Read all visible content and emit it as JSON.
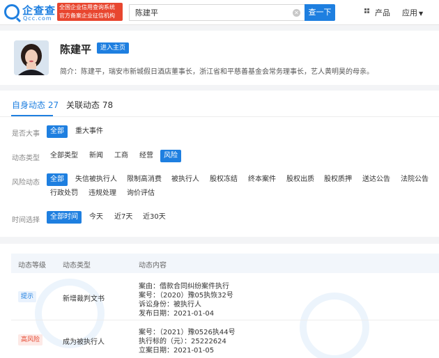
{
  "header": {
    "logo_cn": "企查查",
    "logo_en": "Qcc.com",
    "promo_lines": [
      "全国企业信用查询系统",
      "官方备案企业征信机构"
    ],
    "search_value": "陈建平",
    "search_button": "查一下",
    "nav_products": "产品",
    "nav_apps": "应用"
  },
  "profile": {
    "name": "陈建平",
    "home_button": "进入主页",
    "intro": "简介：陈建平，瑞安市新城假日酒店董事长，浙江省和平慈善基金会常务理事长，艺人黄明昊的母亲。"
  },
  "tabs": [
    {
      "label": "自身动态 27",
      "active": true
    },
    {
      "label": "关联动态 78",
      "active": false
    }
  ],
  "filters": {
    "major": {
      "label": "是否大事",
      "options": [
        "全部",
        "重大事件"
      ],
      "selected": 0
    },
    "type": {
      "label": "动态类型",
      "options": [
        "全部类型",
        "新闻",
        "工商",
        "经营",
        "风险"
      ],
      "selected": 4
    },
    "risk": {
      "label": "风险动态",
      "options": [
        "全部",
        "失信被执行人",
        "限制高消费",
        "被执行人",
        "股权冻结",
        "终本案件",
        "股权出质",
        "股权质押",
        "送达公告",
        "法院公告",
        "行政处罚",
        "违规处理",
        "询价评估"
      ],
      "selected": 0
    },
    "time": {
      "label": "时间选择",
      "options": [
        "全部时间",
        "今天",
        "近7天",
        "近30天"
      ],
      "selected": 0
    }
  },
  "table": {
    "headers": [
      "动态等级",
      "动态类型",
      "动态内容"
    ],
    "rows": [
      {
        "level": "提示",
        "level_kind": "tip",
        "type": "新增裁判文书",
        "lines": [
          "案由：借款合同纠纷案件执行",
          "案号：（2020）豫05执恢32号",
          "诉讼身份：被执行人",
          "发布日期：2021-01-04"
        ]
      },
      {
        "level": "高风险",
        "level_kind": "high",
        "type": "成为被执行人",
        "lines": [
          "案号：（2021）豫0526执44号",
          "执行标的（元）：25222624",
          "立案日期：2021-01-05"
        ]
      }
    ]
  },
  "colors": {
    "accent": "#1e7fe0",
    "danger": "#e5472f",
    "promo": "#e8462f"
  },
  "icons": [
    "search-logo-icon",
    "clear-icon",
    "grid-icon",
    "chevron-down-icon"
  ]
}
